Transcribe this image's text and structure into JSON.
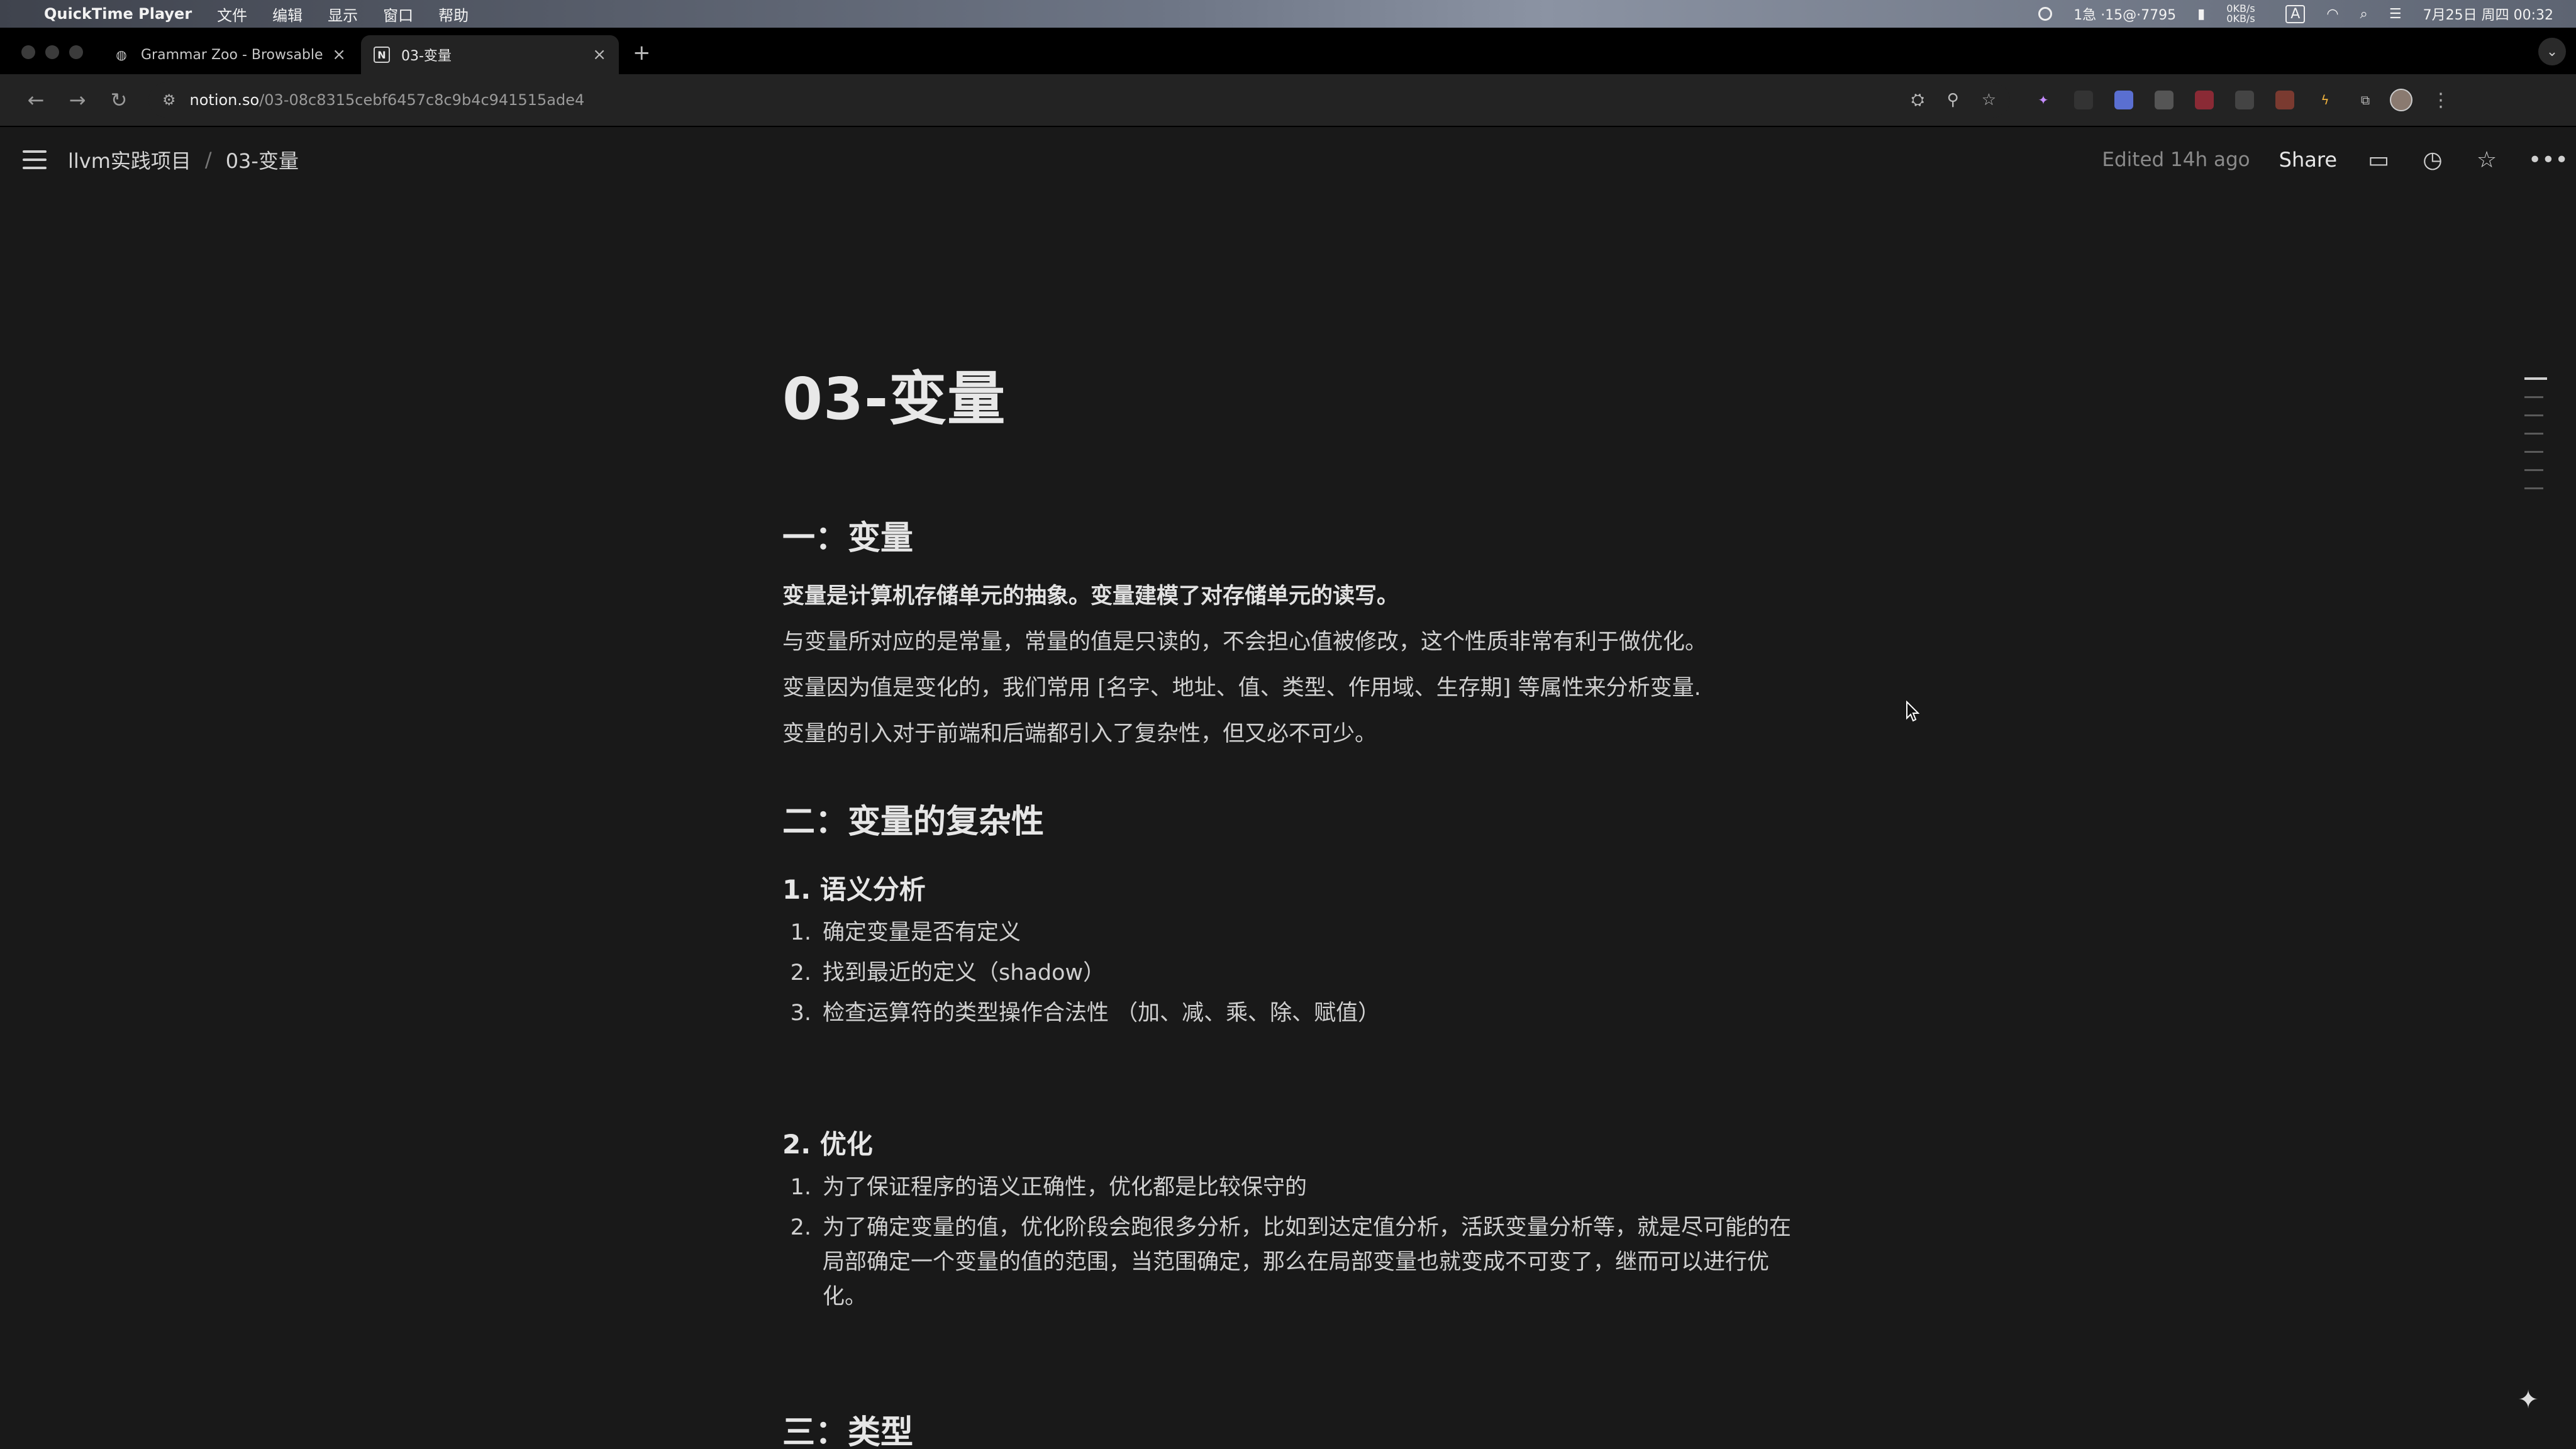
{
  "menubar": {
    "app_name": "QuickTime Player",
    "menus": [
      "文件",
      "编辑",
      "显示",
      "窗口",
      "帮助"
    ],
    "status_text": "1急 ·15@·7795",
    "net_speed": "0KB/s 0KB/s",
    "input_method": "A",
    "datetime": "7月25日 周四 00:32"
  },
  "tabs": [
    {
      "title": "Grammar Zoo - Browsable C",
      "icon": "globe-icon"
    },
    {
      "title": "03-变量",
      "icon": "notion-icon"
    }
  ],
  "address": {
    "host": "notion.so",
    "path": "/03-08c8315cebf6457c8c9b4c941515ade4"
  },
  "breadcrumb": {
    "parent": "llvm实践项目",
    "current": "03-变量"
  },
  "topbar": {
    "edited": "Edited 14h ago",
    "share": "Share"
  },
  "doc": {
    "title": "03-变量",
    "s1_heading": "一：变量",
    "s1_p1": "变量是计算机存储单元的抽象。变量建模了对存储单元的读写。",
    "s1_p2": "与变量所对应的是常量，常量的值是只读的，不会担心值被修改，这个性质非常有利于做优化。",
    "s1_p3": "变量因为值是变化的，我们常用 [名字、地址、值、类型、作用域、生存期] 等属性来分析变量.",
    "s1_p4": "变量的引入对于前端和后端都引入了复杂性，但又必不可少。",
    "s2_heading": "二：变量的复杂性",
    "s2_sub1": "1. 语义分析",
    "s2_list1": [
      {
        "num": "1.",
        "text": "确定变量是否有定义"
      },
      {
        "num": "2.",
        "text": "找到最近的定义（shadow）"
      },
      {
        "num": "3.",
        "text": "检查运算符的类型操作合法性 （加、减、乘、除、赋值）"
      }
    ],
    "s2_sub2": "2. 优化",
    "s2_list2": [
      {
        "num": "1.",
        "text": "为了保证程序的语义正确性，优化都是比较保守的"
      },
      {
        "num": "2.",
        "text": "为了确定变量的值，优化阶段会跑很多分析，比如到达定值分析，活跃变量分析等，就是尽可能的在局部确定一个变量的值的范围，当范围确定，那么在局部变量也就变成不可变了，继而可以进行优化。"
      }
    ],
    "s3_heading": "三：类型"
  }
}
